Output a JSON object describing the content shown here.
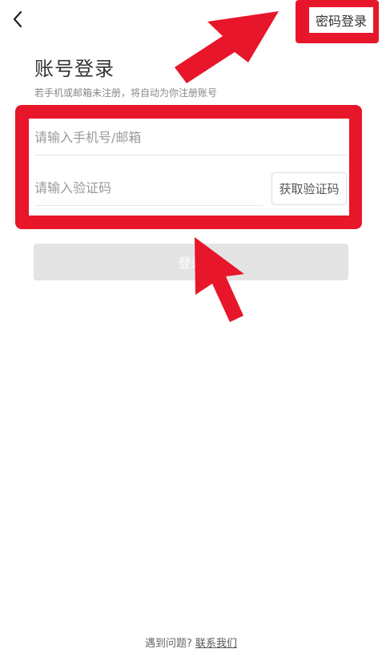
{
  "header": {
    "back_icon": "chevron-left-icon",
    "password_login_label": "密码登录"
  },
  "main": {
    "title": "账号登录",
    "subtitle": "若手机或邮箱未注册，将自动为你注册账号",
    "phone_placeholder": "请输入手机号/邮箱",
    "code_placeholder": "请输入验证码",
    "get_code_label": "获取验证码",
    "login_label": "登录"
  },
  "footer": {
    "question_text": "遇到问题? ",
    "contact_label": "联系我们"
  },
  "colors": {
    "annotation_red": "#e8162a",
    "login_disabled_bg": "#e4e4e4"
  }
}
